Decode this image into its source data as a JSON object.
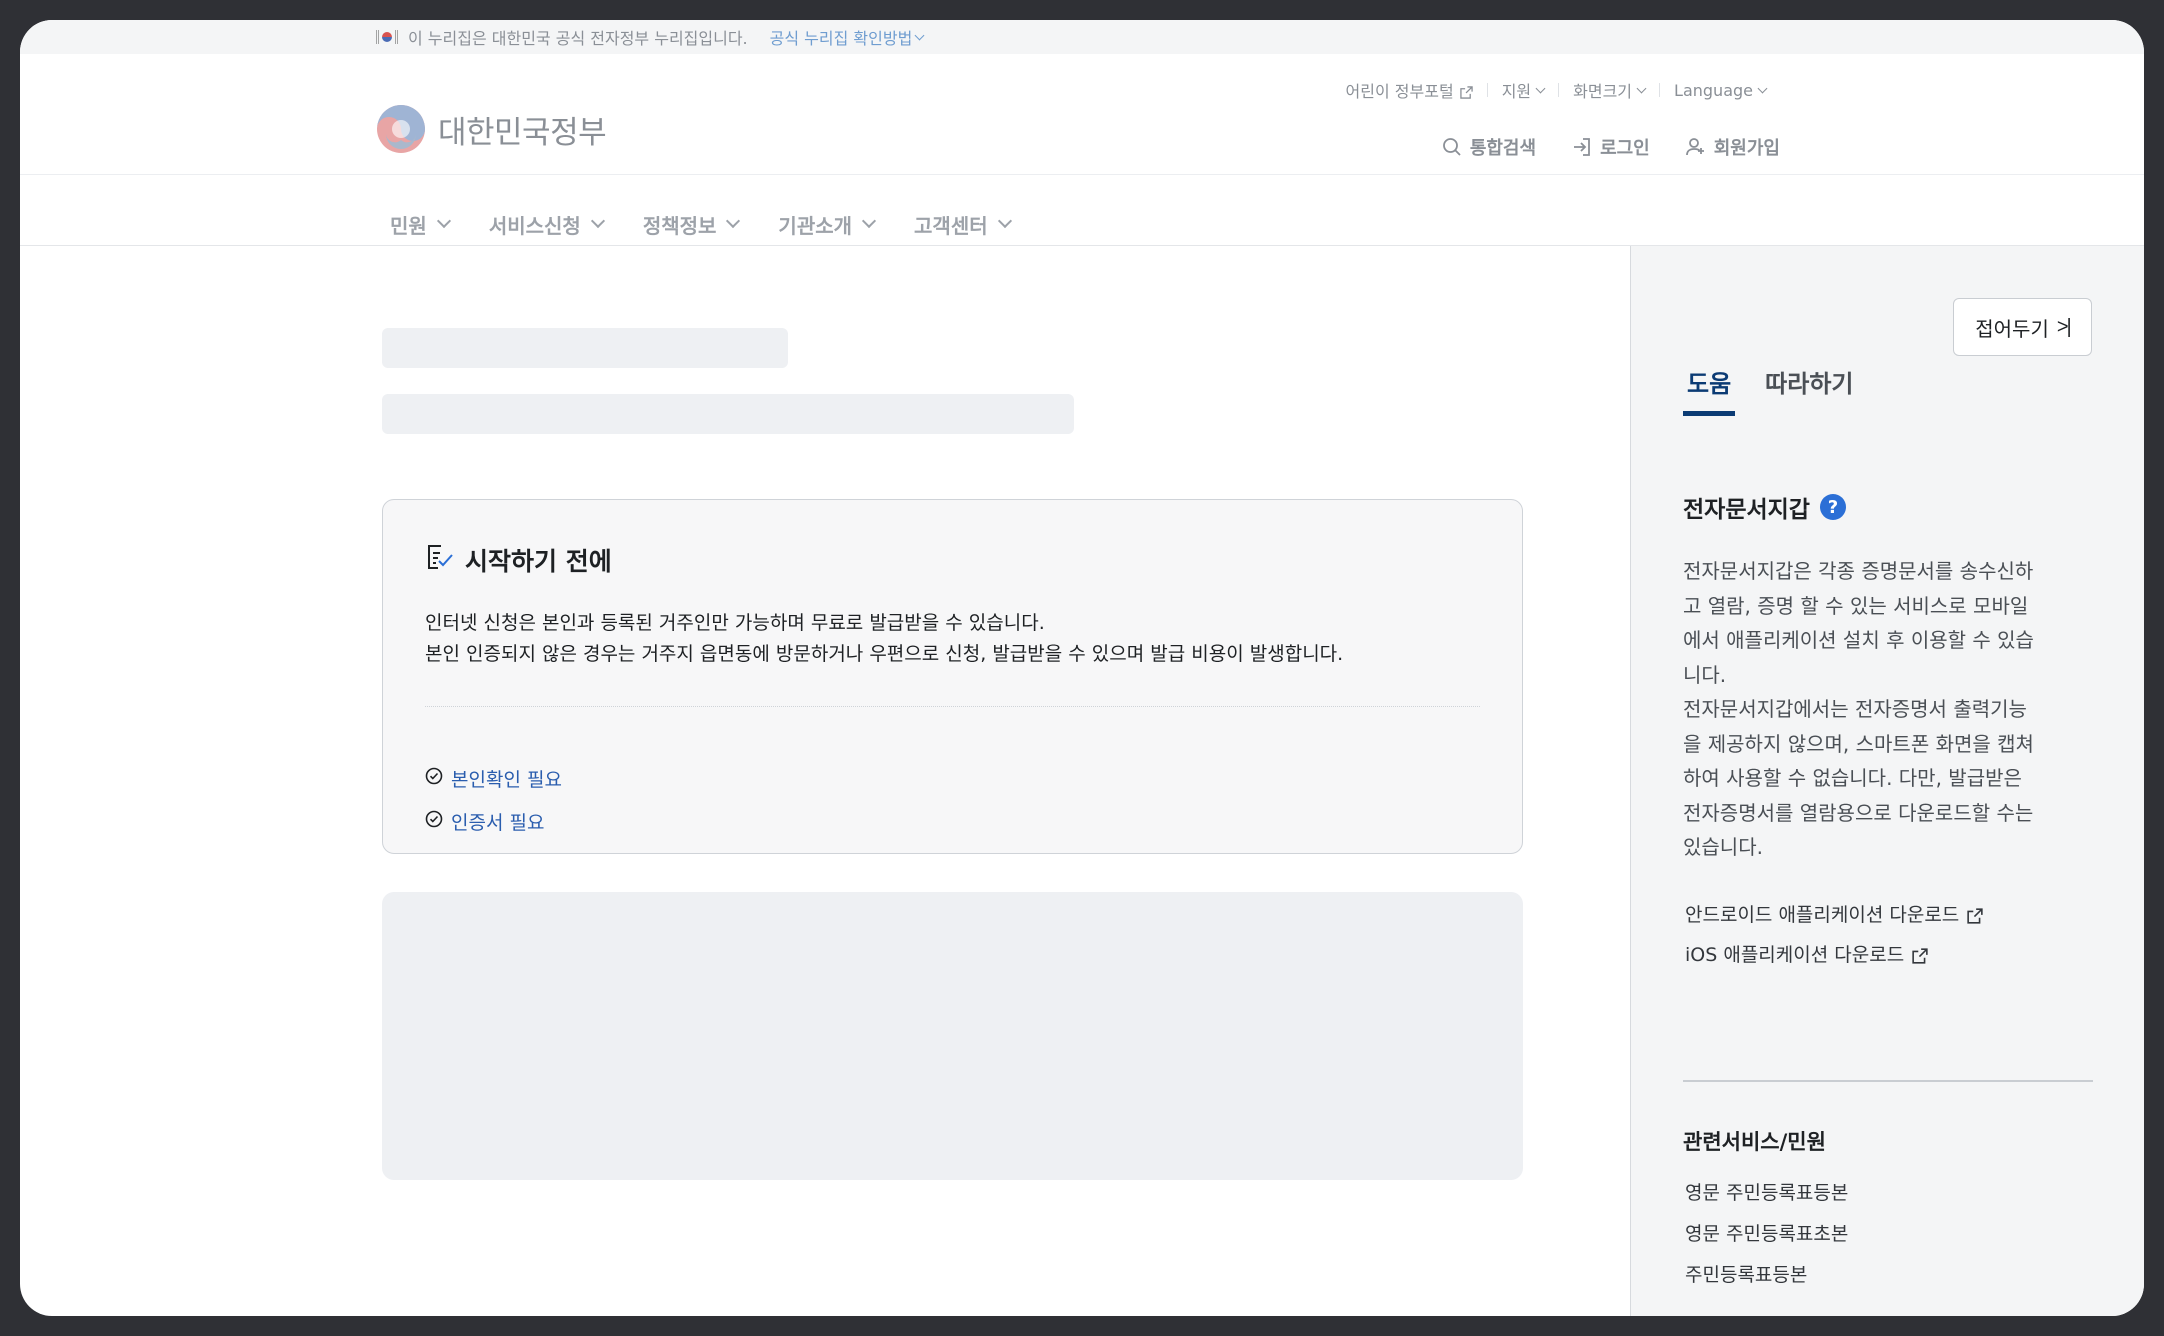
{
  "banner": {
    "text": "이 누리집은 대한민국 공식 전자정부 누리집입니다.",
    "verify_link": "공식 누리집 확인방법"
  },
  "utility": {
    "kids_portal": "어린이 정부포털",
    "support": "지원",
    "screen_size": "화면크기",
    "language": "Language"
  },
  "header": {
    "logo_text": "대한민국정부",
    "search": "통합검색",
    "login": "로그인",
    "signup": "회원가입"
  },
  "gnb": {
    "items": [
      "민원",
      "서비스신청",
      "정책정보",
      "기관소개",
      "고객센터"
    ]
  },
  "notice": {
    "title": "시작하기 전에",
    "lines": [
      "인터넷 신청은 본인과 등록된 거주인만 가능하며 무료로 발급받을 수 있습니다.",
      "본인 인증되지 않은 경우는 거주지 읍면동에 방문하거나 우편으로 신청, 발급받을 수 있으며 발급 비용이 발생합니다."
    ],
    "requirements": [
      "본인확인 필요",
      "인증서 필요"
    ]
  },
  "panel": {
    "collapse_label": "접어두기",
    "collapse_symbol": ">|",
    "tabs": [
      "도움",
      "따라하기"
    ],
    "help_title": "전자문서지갑",
    "help_desc_lines": [
      "전자문서지갑은 각종 증명문서를 송수신하",
      "고 열람, 증명 할 수 있는 서비스로 모바일",
      "에서 애플리케이션 설치 후 이용할 수 있습",
      "니다.",
      "전자문서지갑에서는 전자증명서 출력기능",
      "을 제공하지 않으며, 스마트폰 화면을 캡쳐",
      "하여 사용할 수 없습니다. 다만, 발급받은",
      "전자증명서를 열람용으로 다운로드할 수는",
      "있습니다."
    ],
    "links": [
      "안드로이드 애플리케이션 다운로드",
      "iOS 애플리케이션 다운로드"
    ],
    "related_title": "관련서비스/민원",
    "related_items": [
      "영문 주민등록표등본",
      "영문 주민등록표초본",
      "주민등록표등본"
    ]
  },
  "colors": {
    "accent": "#0b3b74",
    "link": "#2a5dae",
    "help_badge": "#2b6fd6"
  }
}
